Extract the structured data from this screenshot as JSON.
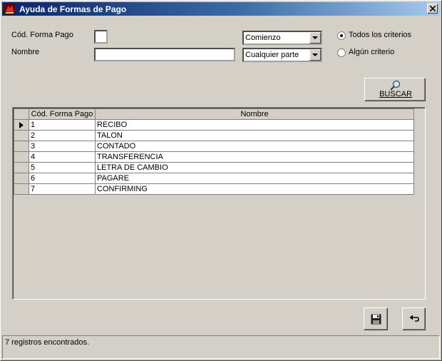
{
  "window": {
    "title": "Ayuda de Formas de Pago"
  },
  "filters": {
    "codigo_label": "Cód. Forma Pago",
    "codigo_value": "",
    "nombre_label": "Nombre",
    "nombre_value": "",
    "codigo_match": "Comienzo",
    "nombre_match": "Cualquier parte",
    "radio_all": "Todos los criterios",
    "radio_any": "Algún criterio",
    "selected_radio": "all"
  },
  "search_button": "BUSCAR",
  "grid": {
    "columns": [
      "Cód. Forma Pago",
      "Nombre"
    ],
    "rows": [
      {
        "code": "1",
        "name": "RECIBO"
      },
      {
        "code": "2",
        "name": "TALON"
      },
      {
        "code": "3",
        "name": "CONTADO"
      },
      {
        "code": "4",
        "name": "TRANSFERENCIA"
      },
      {
        "code": "5",
        "name": "LETRA DE CAMBIO"
      },
      {
        "code": "6",
        "name": "PAGARE"
      },
      {
        "code": "7",
        "name": "CONFIRMING"
      }
    ],
    "current_row": 0
  },
  "icons": {
    "app": "app-icon",
    "close": "close-icon",
    "search": "magnifier-icon",
    "save": "floppy-disk-icon",
    "undo": "undo-arrow-icon"
  },
  "status": "7 registros encontrados."
}
